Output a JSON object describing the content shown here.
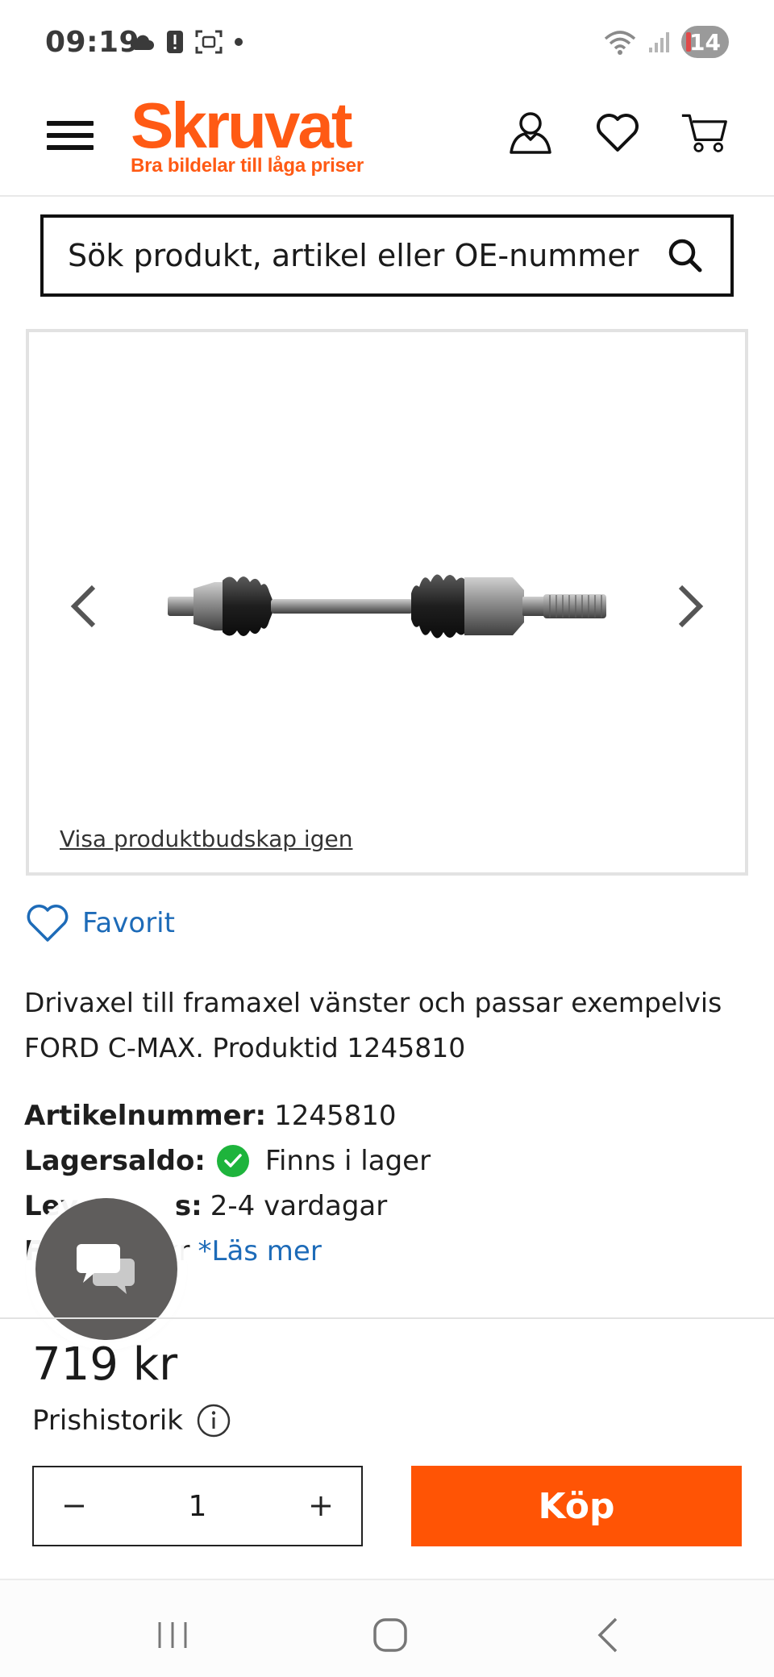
{
  "status_bar": {
    "time": "09:19",
    "notification_count": "14"
  },
  "header": {
    "brand": "Skruvat",
    "tagline": "Bra bildelar till låga priser",
    "icons": [
      "menu-icon",
      "account-icon",
      "heart-icon",
      "cart-icon"
    ]
  },
  "search": {
    "placeholder": "Sök produkt, artikel eller OE-nummer"
  },
  "gallery": {
    "show_message_link": "Visa produktbudskap igen",
    "product_image": "drive shaft"
  },
  "favorite": {
    "label": "Favorit"
  },
  "product": {
    "description": "Drivaxel till framaxel vänster och passar exempelvis FORD C-MAX. Produktid 1245810"
  },
  "specs": {
    "article_label": "Artikelnummer:",
    "article_value": "1245810",
    "stock_label": "Lagersaldo:",
    "stock_value": "Finns i lager",
    "delivery_label": "Leveranstid:",
    "delivery_visible_label": "Lev",
    "delivery_tail_label": "s:",
    "delivery_value": "2-4 vardagar",
    "shipping_visible_label": "Fr",
    "shipping_value": "kr",
    "read_more": "*Läs mer"
  },
  "purchase": {
    "price": "719 kr",
    "price_history_label": "Prishistorik",
    "quantity": "1",
    "buy_label": "Köp"
  },
  "colors": {
    "brand_orange": "#ff5a14",
    "buy_orange": "#ff5405",
    "link_blue": "#1d6bb8",
    "stock_green": "#1eb43c",
    "chat_grey": "#5f5d5c"
  }
}
